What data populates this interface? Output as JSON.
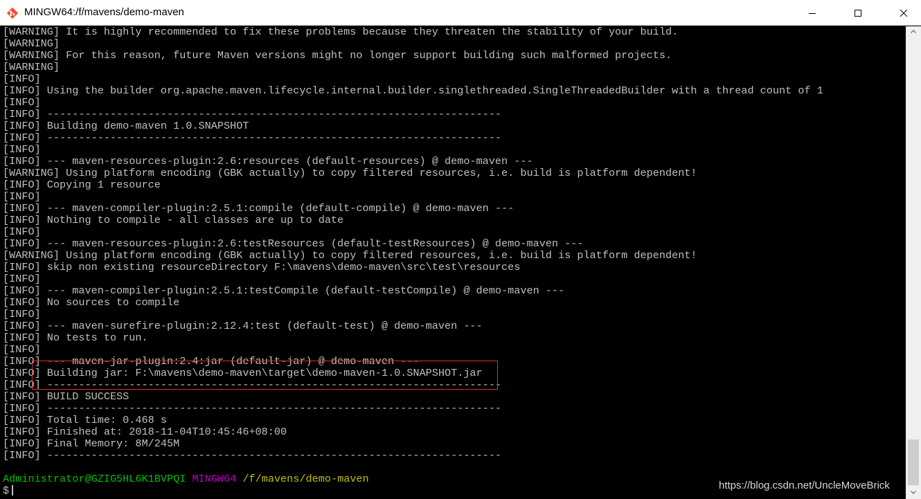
{
  "window": {
    "title": "MINGW64:/f/mavens/demo-maven",
    "icon": "git-bash-icon",
    "controls": {
      "minimize": "minimize-icon",
      "maximize": "maximize-icon",
      "close": "close-icon"
    }
  },
  "terminal": {
    "colors": {
      "text": "#c0c0c0",
      "user": "#00c000",
      "system": "#c000c0",
      "path": "#c0c000",
      "background": "#000000",
      "highlight": "#e03030"
    },
    "lines": [
      "[WARNING] It is highly recommended to fix these problems because they threaten the stability of your build.",
      "[WARNING]",
      "[WARNING] For this reason, future Maven versions might no longer support building such malformed projects.",
      "[WARNING]",
      "[INFO]",
      "[INFO] Using the builder org.apache.maven.lifecycle.internal.builder.singlethreaded.SingleThreadedBuilder with a thread count of 1",
      "[INFO]",
      "[INFO] ------------------------------------------------------------------------",
      "[INFO] Building demo-maven 1.0.SNAPSHOT",
      "[INFO] ------------------------------------------------------------------------",
      "[INFO]",
      "[INFO] --- maven-resources-plugin:2.6:resources (default-resources) @ demo-maven ---",
      "[WARNING] Using platform encoding (GBK actually) to copy filtered resources, i.e. build is platform dependent!",
      "[INFO] Copying 1 resource",
      "[INFO]",
      "[INFO] --- maven-compiler-plugin:2.5.1:compile (default-compile) @ demo-maven ---",
      "[INFO] Nothing to compile - all classes are up to date",
      "[INFO]",
      "[INFO] --- maven-resources-plugin:2.6:testResources (default-testResources) @ demo-maven ---",
      "[WARNING] Using platform encoding (GBK actually) to copy filtered resources, i.e. build is platform dependent!",
      "[INFO] skip non existing resourceDirectory F:\\mavens\\demo-maven\\src\\test\\resources",
      "[INFO]",
      "[INFO] --- maven-compiler-plugin:2.5.1:testCompile (default-testCompile) @ demo-maven ---",
      "[INFO] No sources to compile",
      "[INFO]",
      "[INFO] --- maven-surefire-plugin:2.12.4:test (default-test) @ demo-maven ---",
      "[INFO] No tests to run.",
      "[INFO]",
      "[INFO] --- maven-jar-plugin:2.4:jar (default-jar) @ demo-maven ---",
      "[INFO] Building jar: F:\\mavens\\demo-maven\\target\\demo-maven-1.0.SNAPSHOT.jar",
      "[INFO] ------------------------------------------------------------------------",
      "[INFO] BUILD SUCCESS",
      "[INFO] ------------------------------------------------------------------------",
      "[INFO] Total time: 0.468 s",
      "[INFO] Finished at: 2018-11-04T10:45:46+08:00",
      "[INFO] Final Memory: 8M/245M",
      "[INFO] ------------------------------------------------------------------------"
    ],
    "prompt": {
      "user": "Administrator@GZIG5HL6K1BVPQI",
      "system": "MINGW64",
      "path": "/f/mavens/demo-maven",
      "symbol": "$"
    },
    "watermark": "https://blog.csdn.net/UncleMoveBrick"
  }
}
